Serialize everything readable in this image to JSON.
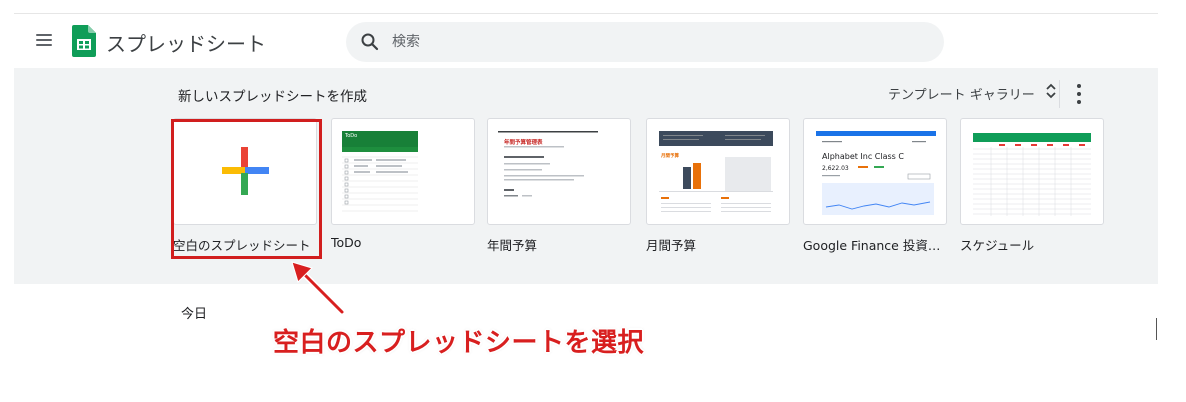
{
  "header": {
    "app_title": "スプレッドシート",
    "search_placeholder": "検索"
  },
  "templates": {
    "section_title": "新しいスプレッドシートを作成",
    "gallery_label": "テンプレート ギャラリー",
    "items": [
      {
        "label": "空白のスプレッドシート"
      },
      {
        "label": "ToDo"
      },
      {
        "label": "年間予算"
      },
      {
        "label": "月間予算"
      },
      {
        "label": "Google Finance 投資ト…"
      },
      {
        "label": "スケジュール"
      }
    ],
    "todo_thumb_title": "ToDo",
    "annual_thumb_title": "年間予算管理表",
    "monthly_thumb_heading": "月間予算",
    "finance_thumb_title": "Alphabet Inc Class C",
    "finance_thumb_price": "2,622.03"
  },
  "recent": {
    "today_label": "今日"
  },
  "annotation": {
    "callout_text": "空白のスプレッドシートを選択",
    "highlight_color": "#d11e1e"
  },
  "colors": {
    "sheets_green": "#0f9d58",
    "plus_red": "#ea4335",
    "plus_blue": "#4285f4",
    "plus_green": "#34a853",
    "plus_yellow": "#fbbc04"
  }
}
